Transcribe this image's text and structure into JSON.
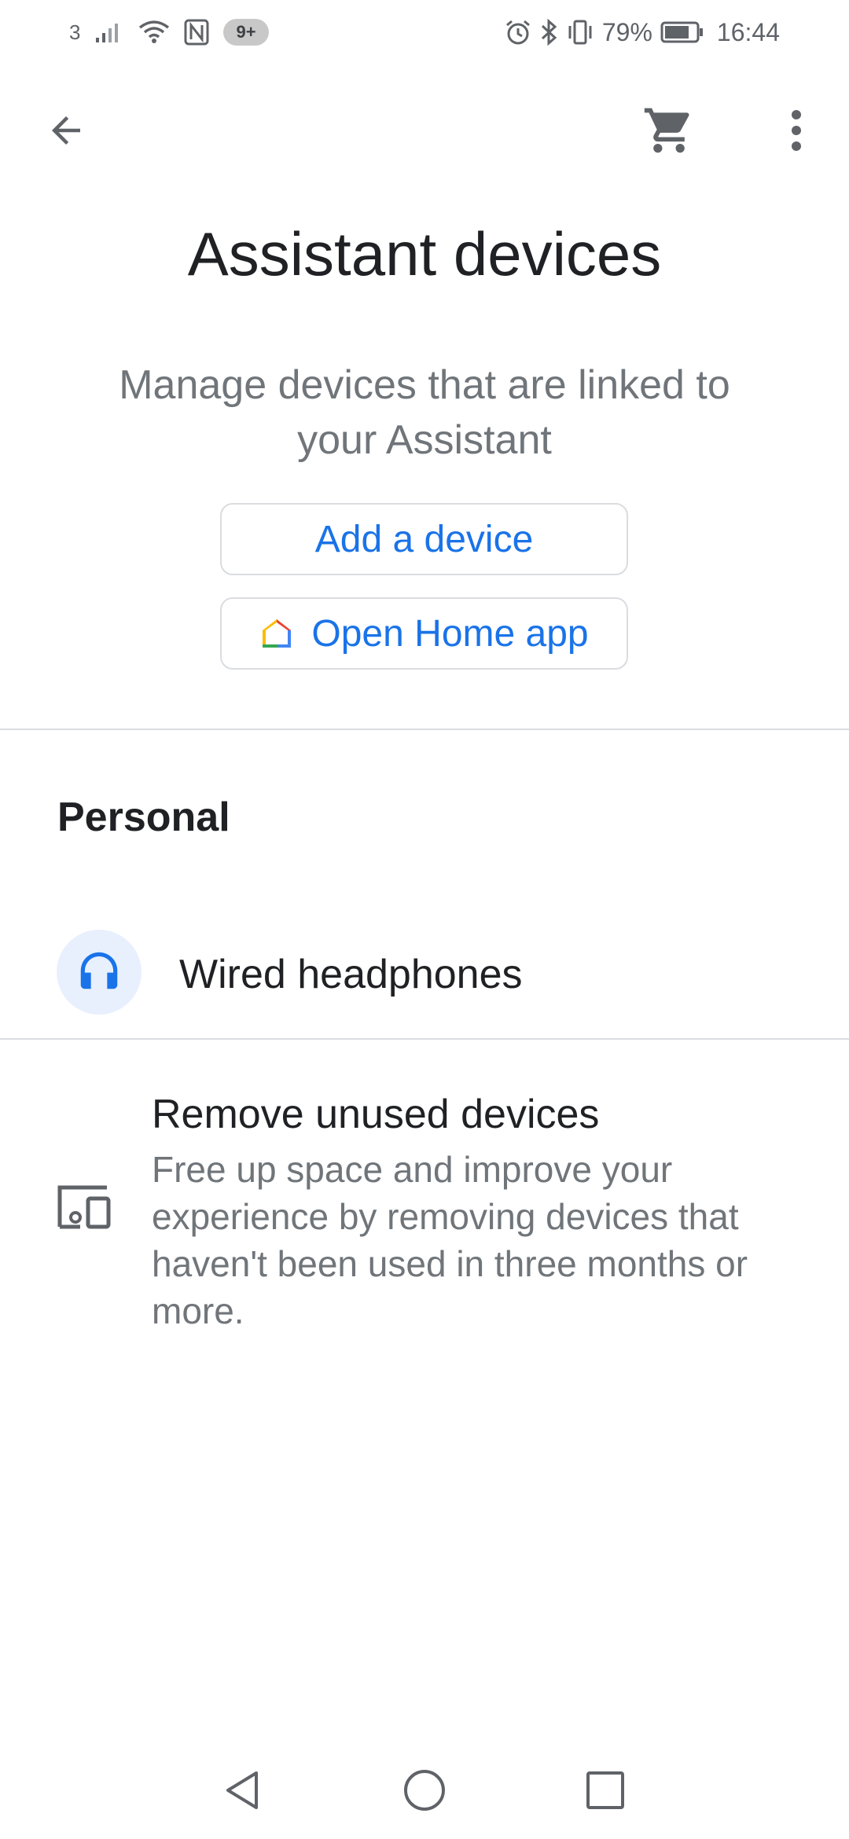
{
  "status_bar": {
    "carrier": "3",
    "notification_badge": "9+",
    "battery_percent": "79%",
    "time": "16:44",
    "icons": [
      "signal-icon",
      "wifi-icon",
      "nfc-icon",
      "alarm-icon",
      "bluetooth-icon",
      "vibrate-icon",
      "battery-icon"
    ]
  },
  "app_bar": {
    "back_icon": "arrow-back-icon",
    "cart_icon": "shopping-cart-icon",
    "more_icon": "more-vert-icon"
  },
  "header": {
    "title": "Assistant devices",
    "subtitle": "Manage devices that are linked to your Assistant",
    "add_device_label": "Add a device",
    "open_home_label": "Open Home app"
  },
  "personal": {
    "section_title": "Personal",
    "devices": [
      {
        "name": "Wired headphones",
        "icon": "headphones-icon"
      }
    ]
  },
  "remove_unused": {
    "title": "Remove unused devices",
    "description": "Free up space and improve your experience by removing devices that haven't been used in three months or more.",
    "icon": "devices-icon"
  },
  "nav_bar": {
    "icons": [
      "nav-back-icon",
      "nav-home-icon",
      "nav-recents-icon"
    ]
  },
  "colors": {
    "accent": "#1a73e8",
    "text_primary": "#202124",
    "text_secondary": "#70757a",
    "divider": "#dadce0",
    "avatar_bg": "#e8f0fe"
  }
}
